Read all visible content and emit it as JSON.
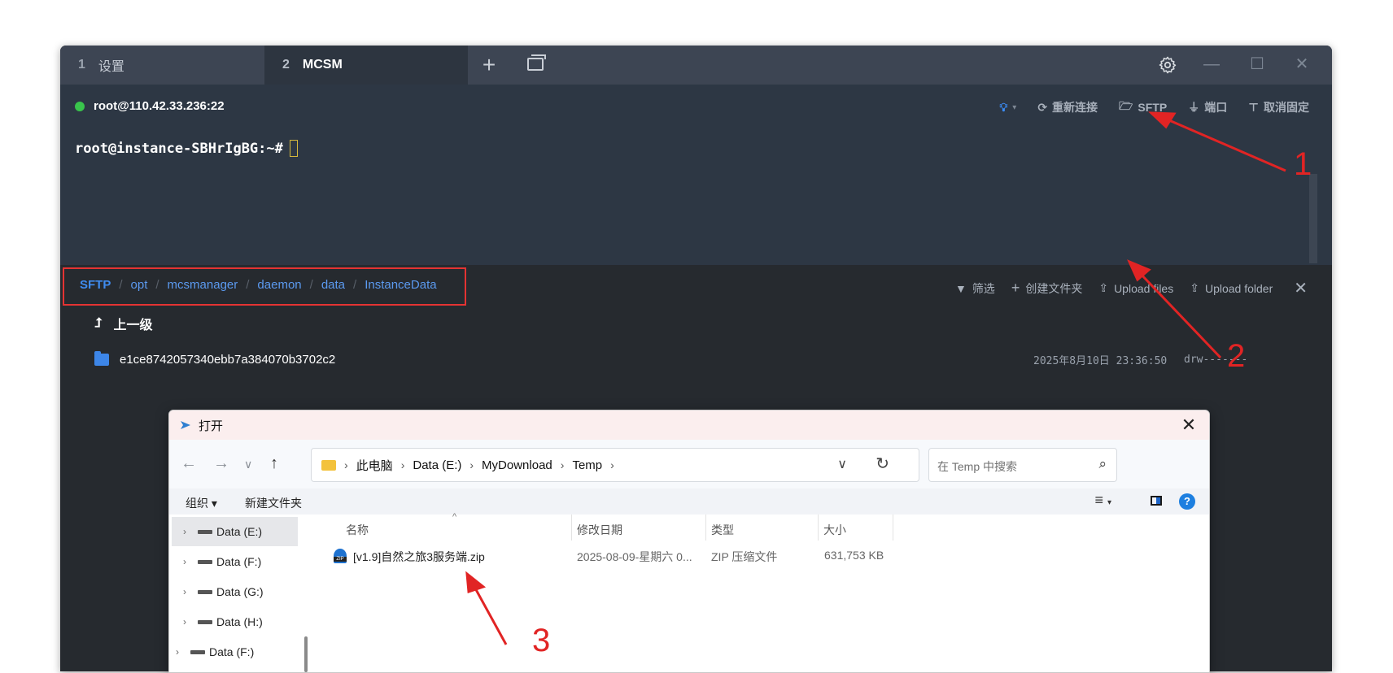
{
  "tabs": [
    {
      "num": "1",
      "label": "设置"
    },
    {
      "num": "2",
      "label": "MCSM"
    }
  ],
  "tabbar": {
    "add_icon": "plus-icon",
    "pane_icon": "window-icon",
    "settings_icon": "gear-icon"
  },
  "terminal": {
    "connection": "root@110.42.33.236:22",
    "status_color": "#39c44c",
    "actions": [
      {
        "icon": "bulb-icon",
        "label": ""
      },
      {
        "icon": "reconnect-icon",
        "label": "重新连接"
      },
      {
        "icon": "folder-open-icon",
        "label": "SFTP"
      },
      {
        "icon": "plug-icon",
        "label": "端口"
      },
      {
        "icon": "pin-icon",
        "label": "取消固定"
      }
    ],
    "prompt": "root@instance-SBHrIgBG:~#"
  },
  "sftp": {
    "breadcrumb": [
      "SFTP",
      "opt",
      "mcsmanager",
      "daemon",
      "data",
      "InstanceData"
    ],
    "actions": [
      {
        "icon": "filter-icon",
        "label": "筛选"
      },
      {
        "icon": "plus-icon",
        "label": "创建文件夹"
      },
      {
        "icon": "upload-icon",
        "label": "Upload files"
      },
      {
        "icon": "upload-icon",
        "label": "Upload folder"
      }
    ],
    "parent_label": "上一级",
    "files": [
      {
        "name": "e1ce8742057340ebb7a384070b3702c2",
        "date": "2025年8月10日 23:36:50",
        "perms": "drw-------"
      }
    ]
  },
  "dialog": {
    "title": "打开",
    "address": [
      "此电脑",
      "Data (E:)",
      "MyDownload",
      "Temp"
    ],
    "search_placeholder": "在 Temp 中搜索",
    "organize": "组织 ▾",
    "new_folder": "新建文件夹",
    "sidebar": [
      "Data (E:)",
      "Data (F:)",
      "Data (G:)",
      "Data (H:)",
      "Data (F:)"
    ],
    "columns": [
      "名称",
      "修改日期",
      "类型",
      "大小"
    ],
    "files": [
      {
        "name": "[v1.9]自然之旅3服务端.zip",
        "modified": "2025-08-09-星期六 0...",
        "type": "ZIP 压缩文件",
        "size": "631,753 KB"
      }
    ]
  },
  "annotations": [
    "1",
    "2",
    "3"
  ],
  "colors": {
    "accent": "#3f8cf0",
    "annotation": "#e12424"
  }
}
